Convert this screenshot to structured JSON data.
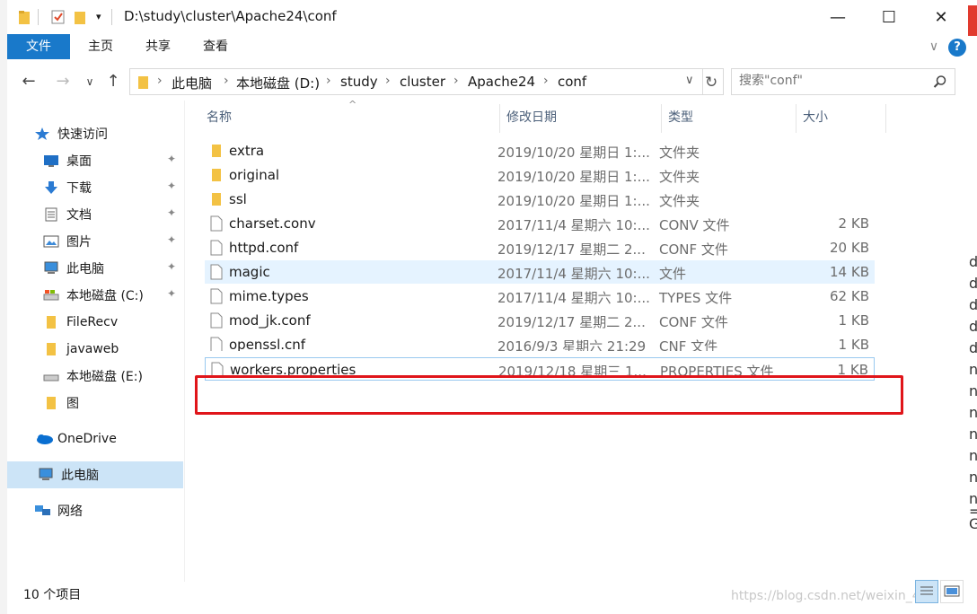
{
  "title": "D:\\study\\cluster\\Apache24\\conf",
  "window_controls": {
    "minimize": "—",
    "maximize": "☐",
    "close": "✕"
  },
  "ribbon": {
    "tabs": [
      {
        "label": "文件"
      },
      {
        "label": "主页"
      },
      {
        "label": "共享"
      },
      {
        "label": "查看"
      }
    ],
    "expand_glyph": "∨",
    "help_glyph": "?"
  },
  "nav": {
    "back": "←",
    "forward": "→",
    "recent": "∨",
    "up": "↑",
    "refresh": "↻"
  },
  "address": {
    "crumbs": [
      "此电脑",
      "本地磁盘 (D:)",
      "study",
      "cluster",
      "Apache24",
      "conf"
    ],
    "separator": "›",
    "dropdown": "∨"
  },
  "search": {
    "placeholder": "搜索\"conf\""
  },
  "sidebar": {
    "items": [
      {
        "label": "快速访问",
        "icon": "star-icon",
        "pinned": false
      },
      {
        "label": "桌面",
        "icon": "desktop-icon",
        "pinned": true
      },
      {
        "label": "下载",
        "icon": "download-icon",
        "pinned": true
      },
      {
        "label": "文档",
        "icon": "document-icon",
        "pinned": true
      },
      {
        "label": "图片",
        "icon": "picture-icon",
        "pinned": true
      },
      {
        "label": "此电脑",
        "icon": "computer-icon",
        "pinned": true
      },
      {
        "label": "本地磁盘 (C:)",
        "icon": "drive-icon",
        "pinned": true
      },
      {
        "label": "FileRecv",
        "icon": "folder-icon",
        "pinned": false
      },
      {
        "label": "javaweb",
        "icon": "folder-icon",
        "pinned": false
      },
      {
        "label": "本地磁盘 (E:)",
        "icon": "drive-icon",
        "pinned": false
      },
      {
        "label": "图",
        "icon": "folder-icon",
        "pinned": false
      },
      {
        "label": "OneDrive",
        "icon": "cloud-icon",
        "pinned": false
      },
      {
        "label": "此电脑",
        "icon": "computer-icon",
        "pinned": false
      },
      {
        "label": "网络",
        "icon": "network-icon",
        "pinned": false
      }
    ],
    "pin_glyph": "📌"
  },
  "columns": {
    "name": "名称",
    "date": "修改日期",
    "type": "类型",
    "size": "大小",
    "sort_glyph": "^"
  },
  "files": [
    {
      "name": "extra",
      "date": "2019/10/20 星期日 1:...",
      "type": "文件夹",
      "size": "",
      "kind": "folder"
    },
    {
      "name": "original",
      "date": "2019/10/20 星期日 1:...",
      "type": "文件夹",
      "size": "",
      "kind": "folder"
    },
    {
      "name": "ssl",
      "date": "2019/10/20 星期日 1:...",
      "type": "文件夹",
      "size": "",
      "kind": "folder"
    },
    {
      "name": "charset.conv",
      "date": "2017/11/4 星期六 10:...",
      "type": "CONV 文件",
      "size": "2 KB",
      "kind": "file"
    },
    {
      "name": "httpd.conf",
      "date": "2019/12/17 星期二 2...",
      "type": "CONF 文件",
      "size": "20 KB",
      "kind": "file"
    },
    {
      "name": "magic",
      "date": "2017/11/4 星期六 10:...",
      "type": "文件",
      "size": "14 KB",
      "kind": "file"
    },
    {
      "name": "mime.types",
      "date": "2017/11/4 星期六 10:...",
      "type": "TYPES 文件",
      "size": "62 KB",
      "kind": "file"
    },
    {
      "name": "mod_jk.conf",
      "date": "2019/12/17 星期二 2...",
      "type": "CONF 文件",
      "size": "1 KB",
      "kind": "file"
    },
    {
      "name": "openssl.cnf",
      "date": "2016/9/3 星期六 21:29",
      "type": "CNF 文件",
      "size": "1 KB",
      "kind": "file"
    },
    {
      "name": "workers.properties",
      "date": "2019/12/18 星期三 1...",
      "type": "PROPERTIES 文件",
      "size": "1 KB",
      "kind": "file"
    }
  ],
  "status": {
    "count": "10 个项目"
  },
  "watermark": "https://blog.csdn.net/weixin_4",
  "right_strip_chars": [
    "d",
    "d",
    "d",
    "d",
    "d",
    "n",
    "n",
    "n",
    "n",
    "n",
    "n",
    "n",
    "=",
    "G"
  ],
  "colors": {
    "accent": "#1979ca",
    "highlight_border": "#e0151a",
    "hover_row": "#e5f3ff",
    "folder": "#f3c244"
  }
}
